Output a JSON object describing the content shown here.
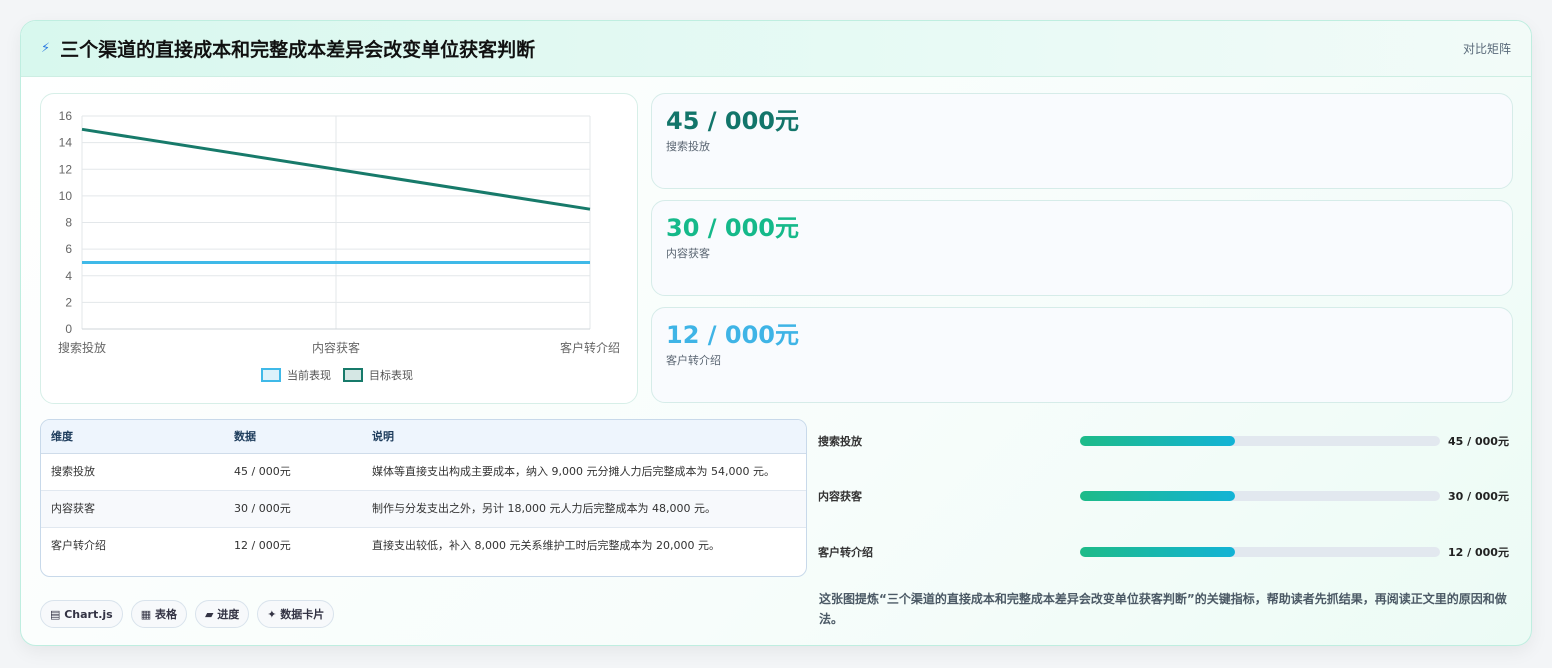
{
  "header": {
    "title": "三个渠道的直接成本和完整成本差异会改变单位获客判断",
    "tag": "对比矩阵",
    "icon": "lightning-icon"
  },
  "chart_data": {
    "type": "line",
    "categories": [
      "搜索投放",
      "内容获客",
      "客户转介绍"
    ],
    "series": [
      {
        "name": "当前表现",
        "values": [
          5,
          5,
          5
        ],
        "color": "#3fb9e8"
      },
      {
        "name": "目标表现",
        "values": [
          15,
          12,
          9
        ],
        "color": "#177a6a"
      }
    ],
    "ylim": [
      0,
      16
    ],
    "yticks": [
      0,
      2,
      4,
      6,
      8,
      10,
      12,
      14,
      16
    ],
    "grid": true,
    "legend": "bottom"
  },
  "kpis": [
    {
      "value": "45 / 000元",
      "label": "搜索投放",
      "color": "#12756a"
    },
    {
      "value": "30 / 000元",
      "label": "内容获客",
      "color": "#15b98a"
    },
    {
      "value": "12 / 000元",
      "label": "客户转介绍",
      "color": "#3fb4e6"
    }
  ],
  "table": {
    "headers": [
      "维度",
      "数据",
      "说明"
    ],
    "rows": [
      [
        "搜索投放",
        "45 / 000元",
        "媒体等直接支出构成主要成本，纳入 9,000 元分摊人力后完整成本为 54,000 元。"
      ],
      [
        "内容获客",
        "30 / 000元",
        "制作与分发支出之外，另计 18,000 元人力后完整成本为 48,000 元。"
      ],
      [
        "客户转介绍",
        "12 / 000元",
        "直接支出较低，补入 8,000 元关系维护工时后完整成本为 20,000 元。"
      ]
    ]
  },
  "chips": [
    "▤ Chart.js",
    "▦ 表格",
    "▰ 进度",
    "✦ 数据卡片"
  ],
  "progress": [
    {
      "label": "搜索投放",
      "value": "45 / 000元",
      "fraction": 0.43
    },
    {
      "label": "内容获客",
      "value": "30 / 000元",
      "fraction": 0.43
    },
    {
      "label": "客户转介绍",
      "value": "12 / 000元",
      "fraction": 0.43
    }
  ],
  "note": "这张图提炼“三个渠道的直接成本和完整成本差异会改变单位获客判断”的关键指标，帮助读者先抓结果，再阅读正文里的原因和做法。"
}
